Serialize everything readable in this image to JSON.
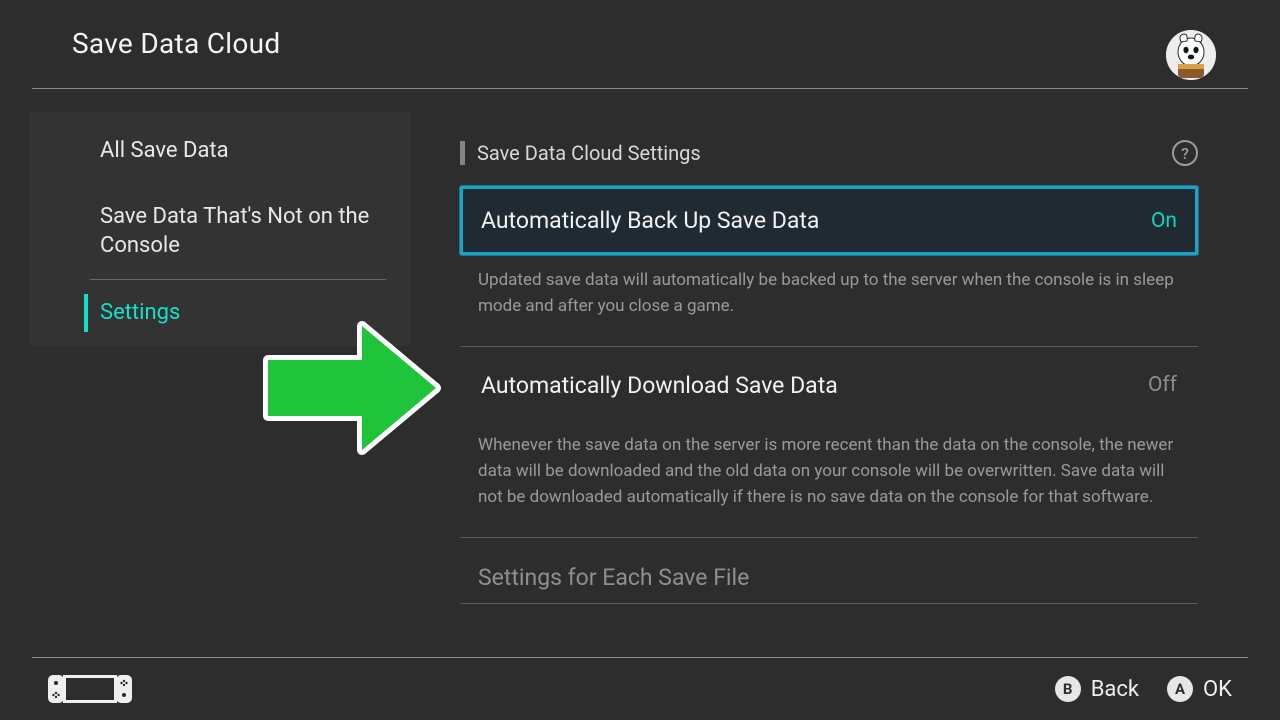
{
  "header": {
    "title": "Save Data Cloud"
  },
  "sidebar": {
    "items": [
      {
        "label": "All Save Data"
      },
      {
        "label": "Save Data That's Not on the Console"
      },
      {
        "label": "Settings"
      }
    ]
  },
  "main": {
    "section_title": "Save Data Cloud Settings",
    "options": [
      {
        "label": "Automatically Back Up Save Data",
        "value": "On",
        "desc": "Updated save data will automatically be backed up to the server when the console is in sleep mode and after you close a game."
      },
      {
        "label": "Automatically Download Save Data",
        "value": "Off",
        "desc": "Whenever the save data on the server is more recent than the data on the console, the newer data will be downloaded and the old data on your console will be overwritten. Save data will not be downloaded automatically if there is no save data on the console for that software."
      }
    ],
    "sub_section": "Settings for Each Save File"
  },
  "footer": {
    "hints": [
      {
        "button": "B",
        "label": "Back"
      },
      {
        "button": "A",
        "label": "OK"
      }
    ]
  },
  "colors": {
    "accent": "#14e0c9",
    "highlight_border": "#1aa3c9",
    "arrow_fill": "#20c43a"
  }
}
